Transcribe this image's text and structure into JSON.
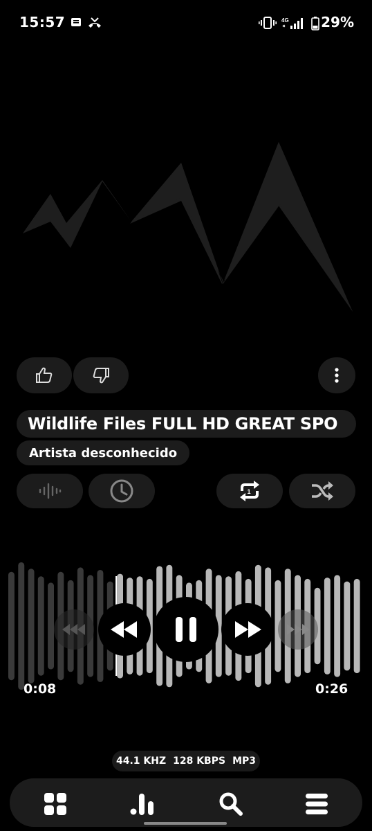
{
  "status_bar": {
    "time": "15:57",
    "battery": "29%",
    "network": "4G",
    "icons": [
      "notification-icon",
      "missed-call-icon",
      "vibrate-icon",
      "signal-icon",
      "battery-icon"
    ]
  },
  "player": {
    "title": "Wildlife Files FULL HD GREAT SPO",
    "artist": "Artista desconhecido",
    "elapsed": "0:08",
    "remaining": "0:26",
    "progress": 0.31,
    "like_icon": "thumbs-up-icon",
    "dislike_icon": "thumbs-down-icon",
    "more_icon": "more-vertical-icon",
    "equalizer_icon": "waveform-icon",
    "timer_icon": "clock-icon",
    "repeat_icon": "repeat-one-icon",
    "shuffle_icon": "shuffle-icon"
  },
  "audio_info": {
    "sample_rate": "44.1 KHZ",
    "bitrate": "128 KBPS",
    "format": "MP3"
  },
  "nav": {
    "items": [
      "grid-icon",
      "bars-chart-icon",
      "search-icon",
      "menu-icon"
    ]
  },
  "colors": {
    "background": "#000000",
    "pill": "#1c1c1c",
    "played_wave": "#3a3a3a",
    "unplayed_wave": "#b8b8b8"
  }
}
